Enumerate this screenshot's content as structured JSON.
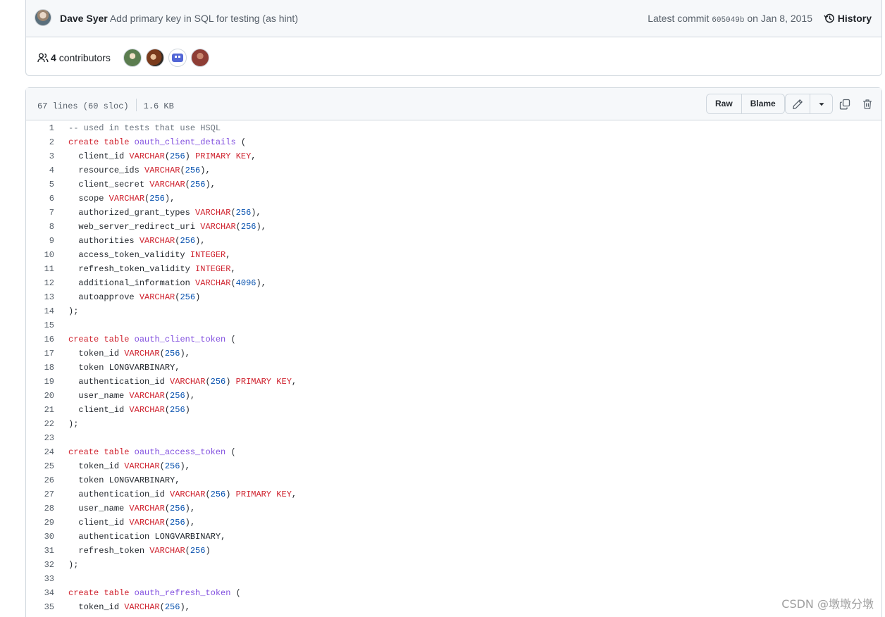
{
  "commit": {
    "author": "Dave Syer",
    "message": "Add primary key in SQL for testing (as hint)",
    "latest_label": "Latest commit",
    "sha": "605049b",
    "date": "on Jan 8, 2015",
    "history_label": "History"
  },
  "contributors": {
    "count": "4",
    "label": "contributors"
  },
  "file": {
    "lines_info": "67 lines (60 sloc)",
    "size": "1.6 KB",
    "raw_label": "Raw",
    "blame_label": "Blame"
  },
  "code_lines": [
    {
      "n": "1",
      "text": "-- used in tests that use HSQL"
    },
    {
      "n": "2",
      "text": "create table oauth_client_details ("
    },
    {
      "n": "3",
      "text": "  client_id VARCHAR(256) PRIMARY KEY,"
    },
    {
      "n": "4",
      "text": "  resource_ids VARCHAR(256),"
    },
    {
      "n": "5",
      "text": "  client_secret VARCHAR(256),"
    },
    {
      "n": "6",
      "text": "  scope VARCHAR(256),"
    },
    {
      "n": "7",
      "text": "  authorized_grant_types VARCHAR(256),"
    },
    {
      "n": "8",
      "text": "  web_server_redirect_uri VARCHAR(256),"
    },
    {
      "n": "9",
      "text": "  authorities VARCHAR(256),"
    },
    {
      "n": "10",
      "text": "  access_token_validity INTEGER,"
    },
    {
      "n": "11",
      "text": "  refresh_token_validity INTEGER,"
    },
    {
      "n": "12",
      "text": "  additional_information VARCHAR(4096),"
    },
    {
      "n": "13",
      "text": "  autoapprove VARCHAR(256)"
    },
    {
      "n": "14",
      "text": ");"
    },
    {
      "n": "15",
      "text": ""
    },
    {
      "n": "16",
      "text": "create table oauth_client_token ("
    },
    {
      "n": "17",
      "text": "  token_id VARCHAR(256),"
    },
    {
      "n": "18",
      "text": "  token LONGVARBINARY,"
    },
    {
      "n": "19",
      "text": "  authentication_id VARCHAR(256) PRIMARY KEY,"
    },
    {
      "n": "20",
      "text": "  user_name VARCHAR(256),"
    },
    {
      "n": "21",
      "text": "  client_id VARCHAR(256)"
    },
    {
      "n": "22",
      "text": ");"
    },
    {
      "n": "23",
      "text": ""
    },
    {
      "n": "24",
      "text": "create table oauth_access_token ("
    },
    {
      "n": "25",
      "text": "  token_id VARCHAR(256),"
    },
    {
      "n": "26",
      "text": "  token LONGVARBINARY,"
    },
    {
      "n": "27",
      "text": "  authentication_id VARCHAR(256) PRIMARY KEY,"
    },
    {
      "n": "28",
      "text": "  user_name VARCHAR(256),"
    },
    {
      "n": "29",
      "text": "  client_id VARCHAR(256),"
    },
    {
      "n": "30",
      "text": "  authentication LONGVARBINARY,"
    },
    {
      "n": "31",
      "text": "  refresh_token VARCHAR(256)"
    },
    {
      "n": "32",
      "text": ");"
    },
    {
      "n": "33",
      "text": ""
    },
    {
      "n": "34",
      "text": "create table oauth_refresh_token ("
    },
    {
      "n": "35",
      "text": "  token_id VARCHAR(256),"
    }
  ],
  "watermark": "CSDN @墩墩分墩",
  "colors": {
    "keyword": "#cf222e",
    "entity": "#8250df",
    "number": "#0550ae",
    "comment": "#6e7781"
  }
}
